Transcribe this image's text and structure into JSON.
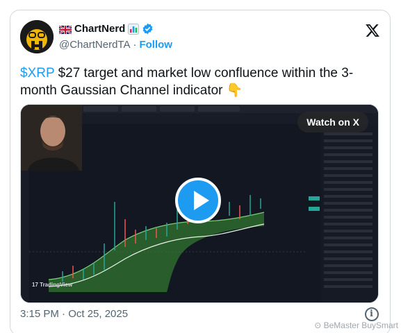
{
  "author": {
    "display_name": "ChartNerd",
    "handle": "@ChartNerdTA",
    "separator": "·",
    "follow_label": "Follow",
    "icons": [
      "uk-flag-icon",
      "bar-chart-icon",
      "verified-badge-icon"
    ]
  },
  "tweet": {
    "cashtag": "$XRP",
    "text": " $27 target and market low confluence within the 3-month Gaussian Channel indicator ",
    "emoji": "👇"
  },
  "media": {
    "watch_label": "Watch on X",
    "play_icon": "play-icon"
  },
  "meta": {
    "timestamp": "3:15 PM · Oct 25, 2025"
  },
  "watermark": "⊙ BeMaster BuySmart",
  "colors": {
    "link_blue": "#1d9bf0",
    "text_primary": "#0f1419",
    "text_secondary": "#536471",
    "chart_bg": "#131722",
    "channel_green": "#4caf50"
  }
}
